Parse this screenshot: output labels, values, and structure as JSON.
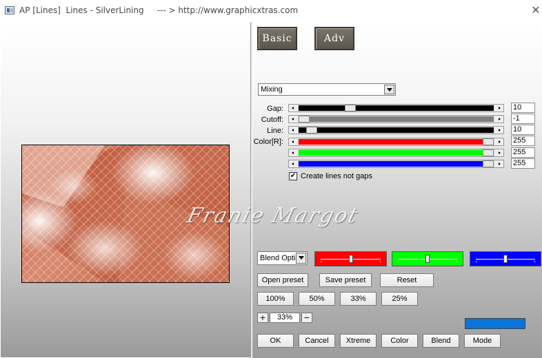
{
  "window": {
    "title": "AP [Lines]  Lines - SilverLining     --- > http://www.graphicxtras.com",
    "close_glyph": "✕"
  },
  "tabs": [
    {
      "label": "Basic"
    },
    {
      "label": "Adv"
    }
  ],
  "mode_dropdown": {
    "selected": "Mixing"
  },
  "sliders": [
    {
      "label": "Gap:",
      "value": "10",
      "fill_color": "#000000",
      "level": 0.25
    },
    {
      "label": "Cutoff:",
      "value": "-1",
      "fill_color": "#808080",
      "level": 0.0
    },
    {
      "label": "Line:",
      "value": "10",
      "fill_color": "#000000",
      "level": 0.04
    },
    {
      "label": "Color[R]:",
      "value": "255",
      "fill_color": "#ff0000",
      "level": 1.0
    },
    {
      "label": "",
      "value": "255",
      "fill_color": "#00ff00",
      "level": 1.0
    },
    {
      "label": "",
      "value": "255",
      "fill_color": "#0000ff",
      "level": 1.0
    }
  ],
  "checkbox": {
    "label": "Create lines not gaps",
    "checked": true,
    "mark": "✔"
  },
  "blend_dropdown": {
    "selected": "Blend Options"
  },
  "channel_boxes": [
    {
      "color": "#ff0000",
      "level": 0.5
    },
    {
      "color": "#00ff00",
      "level": 0.5
    },
    {
      "color": "#0000ff",
      "level": 0.5
    }
  ],
  "preset_buttons": {
    "open": "Open preset",
    "save": "Save preset",
    "reset": "Reset"
  },
  "zoom_buttons": [
    "100%",
    "50%",
    "33%",
    "25%"
  ],
  "zoom_stepper": {
    "plus": "+",
    "value": "33%",
    "minus": "−"
  },
  "swatch_color": "#0a74d8",
  "bottom_buttons": {
    "ok": "OK",
    "cancel": "Cancel",
    "xtreme": "Xtreme",
    "color": "Color",
    "blend": "Blend",
    "mode": "Mode"
  },
  "watermark": "Franie Margot"
}
